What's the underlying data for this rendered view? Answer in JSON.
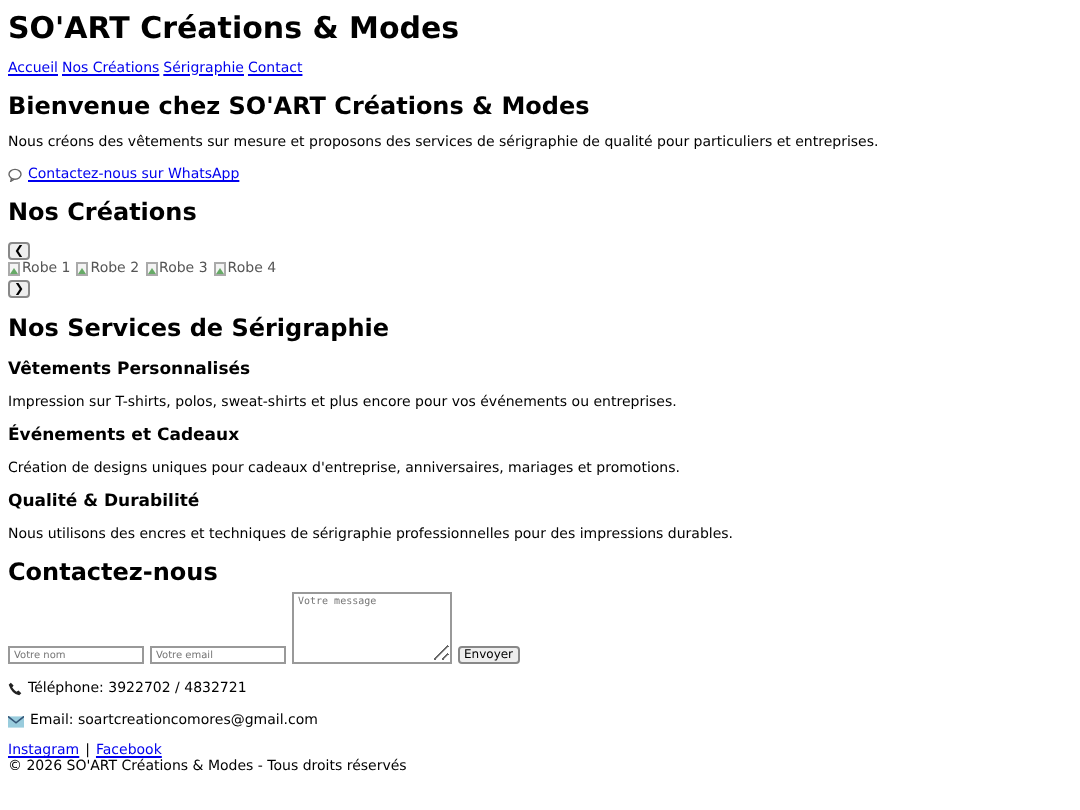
{
  "header": {
    "title": "SO'ART Créations & Modes",
    "nav": [
      "Accueil",
      "Nos Créations",
      "Sérigraphie",
      "Contact"
    ]
  },
  "welcome": {
    "heading": "Bienvenue chez SO'ART Créations & Modes",
    "text": "Nous créons des vêtements sur mesure et proposons des services de sérigraphie de qualité pour particuliers et entreprises.",
    "whatsapp": "Contactez-nous sur WhatsApp"
  },
  "creations": {
    "heading": "Nos Créations",
    "prev": "❮",
    "next": "❯",
    "images": [
      "Robe 1",
      "Robe 2",
      "Robe 3",
      "Robe 4"
    ]
  },
  "services": {
    "heading": "Nos Services de Sérigraphie",
    "items": [
      {
        "title": "Vêtements Personnalisés",
        "text": "Impression sur T-shirts, polos, sweat-shirts et plus encore pour vos événements ou entreprises."
      },
      {
        "title": "Événements et Cadeaux",
        "text": "Création de designs uniques pour cadeaux d'entreprise, anniversaires, mariages et promotions."
      },
      {
        "title": "Qualité & Durabilité",
        "text": "Nous utilisons des encres et techniques de sérigraphie professionnelles pour des impressions durables."
      }
    ]
  },
  "contact": {
    "heading": "Contactez-nous",
    "name_placeholder": "Votre nom",
    "email_placeholder": "Votre email",
    "message_placeholder": "Votre message",
    "submit": "Envoyer",
    "phone": "Téléphone: 3922702 / 4832721",
    "email": "Email: soartcreationcomores@gmail.com"
  },
  "footer": {
    "links": [
      "Instagram",
      "Facebook"
    ],
    "separator": "|",
    "copyright": "© 2026 SO'ART Créations & Modes - Tous droits réservés"
  }
}
